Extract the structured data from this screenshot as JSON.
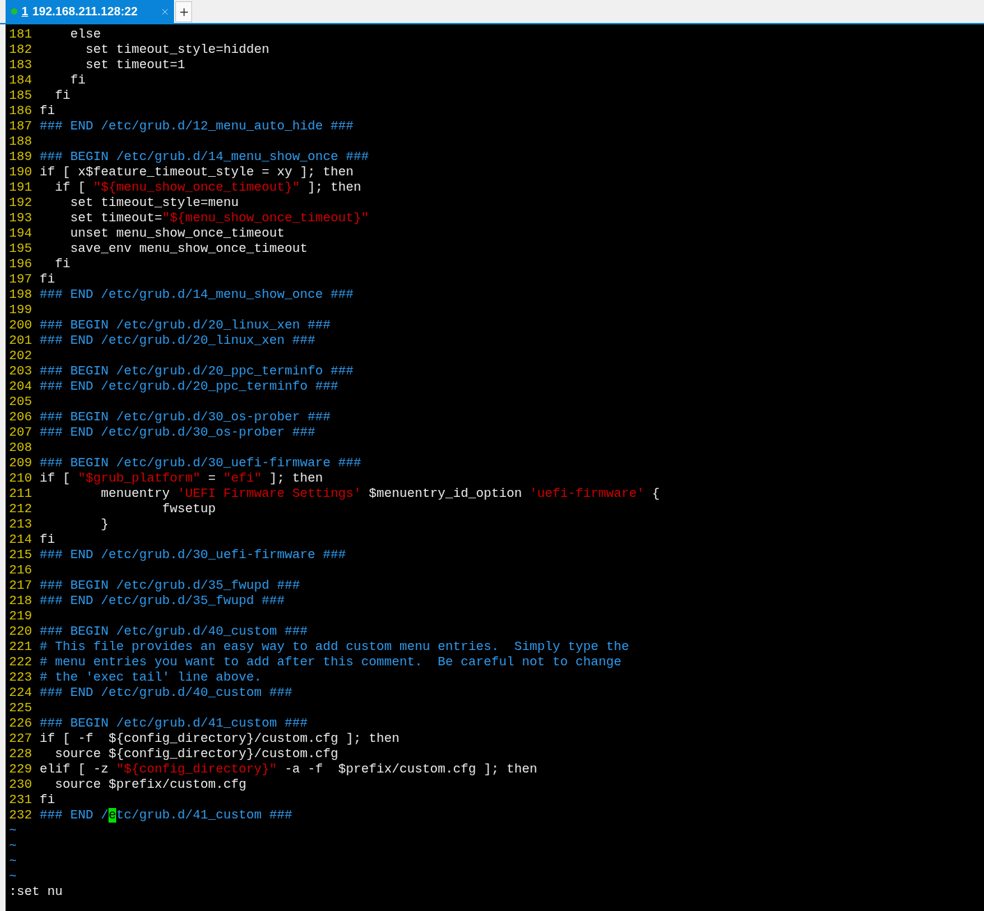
{
  "tabs": [
    {
      "index": "1",
      "title": "192.168.211.128:22",
      "selected": true,
      "color": "#1fbf2f"
    }
  ],
  "editor": {
    "lines": [
      {
        "number": "181",
        "segments": [
          {
            "kind": "plain",
            "text": "    else"
          }
        ]
      },
      {
        "number": "182",
        "segments": [
          {
            "kind": "plain",
            "text": "      set timeout_style=hidden"
          }
        ]
      },
      {
        "number": "183",
        "segments": [
          {
            "kind": "plain",
            "text": "      set timeout=1"
          }
        ]
      },
      {
        "number": "184",
        "segments": [
          {
            "kind": "plain",
            "text": "    fi"
          }
        ]
      },
      {
        "number": "185",
        "segments": [
          {
            "kind": "plain",
            "text": "  fi"
          }
        ]
      },
      {
        "number": "186",
        "segments": [
          {
            "kind": "plain",
            "text": "fi"
          }
        ]
      },
      {
        "number": "187",
        "segments": [
          {
            "kind": "comment",
            "text": "### END /etc/grub.d/12_menu_auto_hide ###"
          }
        ]
      },
      {
        "number": "188"
      },
      {
        "number": "189",
        "segments": [
          {
            "kind": "comment",
            "text": "### BEGIN /etc/grub.d/14_menu_show_once ###"
          }
        ]
      },
      {
        "number": "190",
        "segments": [
          {
            "kind": "plain",
            "text": "if [ x$feature_timeout_style = xy ]; then"
          }
        ]
      },
      {
        "number": "191",
        "segments": [
          {
            "kind": "plain",
            "text": "  if [ "
          },
          {
            "kind": "string",
            "text": "\"${menu_show_once_timeout}\""
          },
          {
            "kind": "plain",
            "text": " ]; then"
          }
        ]
      },
      {
        "number": "192",
        "segments": [
          {
            "kind": "plain",
            "text": "    set timeout_style=menu"
          }
        ]
      },
      {
        "number": "193",
        "segments": [
          {
            "kind": "plain",
            "text": "    set timeout="
          },
          {
            "kind": "string",
            "text": "\"${menu_show_once_timeout}\""
          }
        ]
      },
      {
        "number": "194",
        "segments": [
          {
            "kind": "plain",
            "text": "    unset menu_show_once_timeout"
          }
        ]
      },
      {
        "number": "195",
        "segments": [
          {
            "kind": "plain",
            "text": "    save_env menu_show_once_timeout"
          }
        ]
      },
      {
        "number": "196",
        "segments": [
          {
            "kind": "plain",
            "text": "  fi"
          }
        ]
      },
      {
        "number": "197",
        "segments": [
          {
            "kind": "plain",
            "text": "fi"
          }
        ]
      },
      {
        "number": "198",
        "segments": [
          {
            "kind": "comment",
            "text": "### END /etc/grub.d/14_menu_show_once ###"
          }
        ]
      },
      {
        "number": "199"
      },
      {
        "number": "200",
        "segments": [
          {
            "kind": "comment",
            "text": "### BEGIN /etc/grub.d/20_linux_xen ###"
          }
        ]
      },
      {
        "number": "201",
        "segments": [
          {
            "kind": "comment",
            "text": "### END /etc/grub.d/20_linux_xen ###"
          }
        ]
      },
      {
        "number": "202"
      },
      {
        "number": "203",
        "segments": [
          {
            "kind": "comment",
            "text": "### BEGIN /etc/grub.d/20_ppc_terminfo ###"
          }
        ]
      },
      {
        "number": "204",
        "segments": [
          {
            "kind": "comment",
            "text": "### END /etc/grub.d/20_ppc_terminfo ###"
          }
        ]
      },
      {
        "number": "205"
      },
      {
        "number": "206",
        "segments": [
          {
            "kind": "comment",
            "text": "### BEGIN /etc/grub.d/30_os-prober ###"
          }
        ]
      },
      {
        "number": "207",
        "segments": [
          {
            "kind": "comment",
            "text": "### END /etc/grub.d/30_os-prober ###"
          }
        ]
      },
      {
        "number": "208"
      },
      {
        "number": "209",
        "segments": [
          {
            "kind": "comment",
            "text": "### BEGIN /etc/grub.d/30_uefi-firmware ###"
          }
        ]
      },
      {
        "number": "210",
        "segments": [
          {
            "kind": "plain",
            "text": "if [ "
          },
          {
            "kind": "string",
            "text": "\"$grub_platform\""
          },
          {
            "kind": "plain",
            "text": " = "
          },
          {
            "kind": "string",
            "text": "\"efi\""
          },
          {
            "kind": "plain",
            "text": " ]; then"
          }
        ]
      },
      {
        "number": "211",
        "segments": [
          {
            "kind": "plain",
            "text": "        menuentry "
          },
          {
            "kind": "string",
            "text": "'UEFI Firmware Settings'"
          },
          {
            "kind": "plain",
            "text": " $menuentry_id_option "
          },
          {
            "kind": "string",
            "text": "'uefi-firmware'"
          },
          {
            "kind": "plain",
            "text": " {"
          }
        ]
      },
      {
        "number": "212",
        "segments": [
          {
            "kind": "plain",
            "text": "                fwsetup"
          }
        ]
      },
      {
        "number": "213",
        "segments": [
          {
            "kind": "plain",
            "text": "        }"
          }
        ]
      },
      {
        "number": "214",
        "segments": [
          {
            "kind": "plain",
            "text": "fi"
          }
        ]
      },
      {
        "number": "215",
        "segments": [
          {
            "kind": "comment",
            "text": "### END /etc/grub.d/30_uefi-firmware ###"
          }
        ]
      },
      {
        "number": "216"
      },
      {
        "number": "217",
        "segments": [
          {
            "kind": "comment",
            "text": "### BEGIN /etc/grub.d/35_fwupd ###"
          }
        ]
      },
      {
        "number": "218",
        "segments": [
          {
            "kind": "comment",
            "text": "### END /etc/grub.d/35_fwupd ###"
          }
        ]
      },
      {
        "number": "219"
      },
      {
        "number": "220",
        "segments": [
          {
            "kind": "comment",
            "text": "### BEGIN /etc/grub.d/40_custom ###"
          }
        ]
      },
      {
        "number": "221",
        "segments": [
          {
            "kind": "comment",
            "text": "# This file provides an easy way to add custom menu entries.  Simply type the"
          }
        ]
      },
      {
        "number": "222",
        "segments": [
          {
            "kind": "comment",
            "text": "# menu entries you want to add after this comment.  Be careful not to change"
          }
        ]
      },
      {
        "number": "223",
        "segments": [
          {
            "kind": "comment",
            "text": "# the 'exec tail' line above."
          }
        ]
      },
      {
        "number": "224",
        "segments": [
          {
            "kind": "comment",
            "text": "### END /etc/grub.d/40_custom ###"
          }
        ]
      },
      {
        "number": "225"
      },
      {
        "number": "226",
        "segments": [
          {
            "kind": "comment",
            "text": "### BEGIN /etc/grub.d/41_custom ###"
          }
        ]
      },
      {
        "number": "227",
        "segments": [
          {
            "kind": "plain",
            "text": "if [ -f  ${config_directory}/custom.cfg ]; then"
          }
        ]
      },
      {
        "number": "228",
        "segments": [
          {
            "kind": "plain",
            "text": "  source ${config_directory}/custom.cfg"
          }
        ]
      },
      {
        "number": "229",
        "segments": [
          {
            "kind": "plain",
            "text": "elif [ -z "
          },
          {
            "kind": "string",
            "text": "\"${config_directory}\""
          },
          {
            "kind": "plain",
            "text": " -a -f  $prefix/custom.cfg ]; then"
          }
        ]
      },
      {
        "number": "230",
        "segments": [
          {
            "kind": "plain",
            "text": "  source $prefix/custom.cfg"
          }
        ]
      },
      {
        "number": "231",
        "segments": [
          {
            "kind": "plain",
            "text": "fi"
          }
        ]
      },
      {
        "number": "232",
        "segments": [
          {
            "kind": "comment",
            "text": "### END /"
          },
          {
            "kind": "cursor",
            "text": "e"
          },
          {
            "kind": "comment",
            "text": "tc/grub.d/41_custom ###"
          }
        ]
      }
    ],
    "empty_markers": [
      "~",
      "~",
      "~",
      "~"
    ],
    "command": ":set nu"
  }
}
